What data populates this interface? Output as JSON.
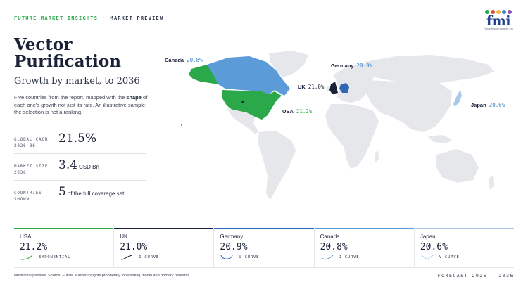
{
  "header": {
    "brand": "FUTURE MARKET INSIGHTS",
    "separator": "·",
    "section": "MARKET PREVIEW"
  },
  "logo": {
    "wordmark": "fmi",
    "tagline": "Future Market Insights, Inc.",
    "dot_colors": [
      "#2aa84a",
      "#e94e3c",
      "#f3b43a",
      "#3f86d0",
      "#8a4fb8"
    ]
  },
  "title": "Vector Purification",
  "subtitle": "Growth by market, to 2036",
  "description": {
    "part1": "Five countries from the report, mapped with the ",
    "bold": "shape",
    "part2": " of each one's growth not just its rate. An illustrative sample; the selection is not a ranking."
  },
  "stats": [
    {
      "label": "GLOBAL CAGR 2026–36",
      "value": "21.5%",
      "unit": ""
    },
    {
      "label": "MARKET SIZE 2036",
      "value": "3.4",
      "unit": "USD Bn"
    },
    {
      "label": "COUNTRIES SHOWN",
      "value": "5",
      "unit": "of the full coverage set"
    }
  ],
  "map_labels": [
    {
      "country": "Canada",
      "value": "20.8%"
    },
    {
      "country": "Germany",
      "value": "20.9%"
    },
    {
      "country": "UK",
      "value": "21.0%"
    },
    {
      "country": "USA",
      "value": "21.2%"
    },
    {
      "country": "Japan",
      "value": "20.6%"
    }
  ],
  "cards": [
    {
      "country": "USA",
      "value": "21.2%",
      "shape": "EXPONENTIAL",
      "color": "#2aa84a"
    },
    {
      "country": "UK",
      "value": "21.0%",
      "shape": "S-CURVE",
      "color": "#1a2238"
    },
    {
      "country": "Germany",
      "value": "20.9%",
      "shape": "U-CURVE",
      "color": "#2f66b6"
    },
    {
      "country": "Canada",
      "value": "20.8%",
      "shape": "J-CURVE",
      "color": "#5a9bd8"
    },
    {
      "country": "Japan",
      "value": "20.6%",
      "shape": "V-CURVE",
      "color": "#a9c9ea"
    }
  ],
  "footer": {
    "source": "Illustrative preview. Source: Future Market Insights proprietary forecasting model and primary research.",
    "forecast": "FORECAST 2026 – 2036"
  },
  "colors": {
    "usa": "#2aa84a",
    "canada": "#5a9bd8",
    "europe_highlight": "#2f66b6",
    "uk": "#1a2238",
    "land": "#e5e7ea"
  }
}
